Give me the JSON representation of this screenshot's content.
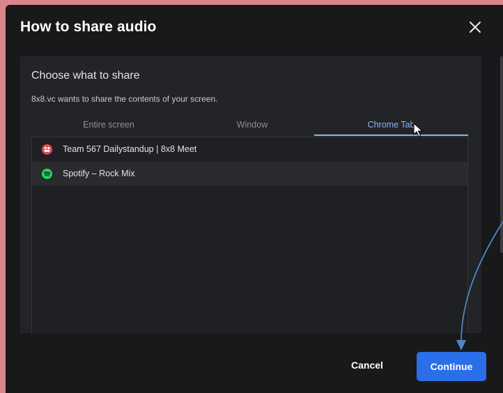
{
  "dialog": {
    "title": "How to share audio",
    "close_icon": "close-icon"
  },
  "picker": {
    "heading": "Choose what to share",
    "subtitle": "8x8.vc wants to share the contents of your screen.",
    "tabs": [
      {
        "label": "Entire screen",
        "active": false
      },
      {
        "label": "Window",
        "active": false
      },
      {
        "label": "Chrome Tab",
        "active": true
      }
    ],
    "items": [
      {
        "label": "Team 567 Dailystandup | 8x8 Meet",
        "icon": "8x8-meet-icon",
        "selected": false
      },
      {
        "label": "Spotify – Rock Mix",
        "icon": "spotify-icon",
        "selected": true
      }
    ]
  },
  "footer": {
    "cancel_label": "Cancel",
    "continue_label": "Continue"
  },
  "colors": {
    "accent": "#2a6ee8",
    "active_tab": "#8ab4f8",
    "background": "#d9868a",
    "spotify": "#1ed760",
    "meet": "#e24a58"
  }
}
